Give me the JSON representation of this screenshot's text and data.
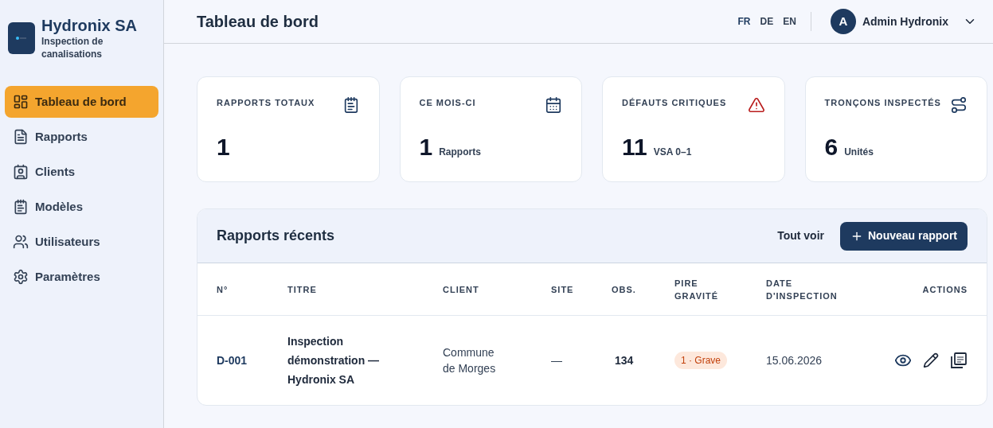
{
  "brand": {
    "name": "Hydronix SA",
    "subtitle": "Inspection de canalisations"
  },
  "nav": [
    {
      "label": "Tableau de bord",
      "selected": true
    },
    {
      "label": "Rapports",
      "selected": false
    },
    {
      "label": "Clients",
      "selected": false
    },
    {
      "label": "Modèles",
      "selected": false
    },
    {
      "label": "Utilisateurs",
      "selected": false
    },
    {
      "label": "Paramètres",
      "selected": false
    }
  ],
  "header": {
    "title": "Tableau de bord",
    "languages": [
      {
        "label": "FR",
        "selected": true
      },
      {
        "label": "DE",
        "selected": false
      },
      {
        "label": "EN",
        "selected": false
      }
    ],
    "user": {
      "initial": "A",
      "name": "Admin Hydronix"
    }
  },
  "stats": [
    {
      "label": "RAPPORTS TOTAUX",
      "value": "1",
      "alert": false
    },
    {
      "label": "CE MOIS-CI",
      "value": "1",
      "unit": "Rapports",
      "alert": false
    },
    {
      "label": "DÉFAUTS CRITIQUES",
      "value": "11",
      "unit": "VSA 0–1",
      "alert": true
    },
    {
      "label": "TRONÇONS INSPECTÉS",
      "value": "6",
      "unit": "Unités",
      "alert": false
    }
  ],
  "recent": {
    "title": "Rapports récents",
    "see_all": "Tout voir",
    "new_button": "Nouveau rapport",
    "columns": [
      "N°",
      "TITRE",
      "CLIENT",
      "SITE",
      "OBS.",
      "PIRE GRAVITÉ",
      "DATE D'INSPECTION",
      "ACTIONS"
    ],
    "rows": [
      {
        "number": "D-001",
        "title": "Inspection démonstration — Hydronix SA",
        "client": "Commune de Morges",
        "site": "—",
        "obs": "134",
        "severity": {
          "label": "1 · Grave",
          "color": "#c2410c"
        },
        "date": "15.06.2026"
      }
    ]
  }
}
